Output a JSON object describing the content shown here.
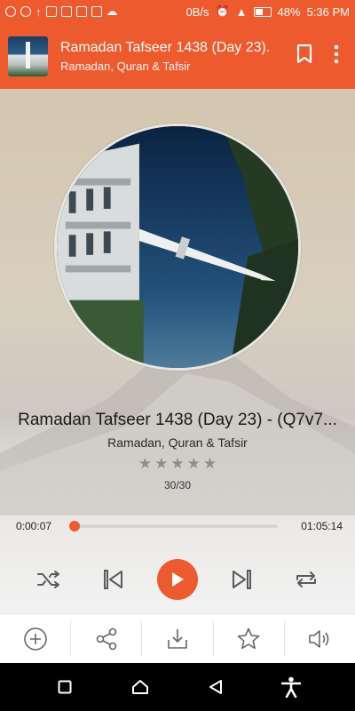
{
  "status_bar": {
    "speed": "0B/s",
    "battery": "48%",
    "time": "5:36 PM"
  },
  "app_bar": {
    "title": "Ramadan Tafseer 1438 (Day 23)..",
    "subtitle": "Ramadan, Quran & Tafsir",
    "icons": [
      "bookmark-icon",
      "more-vert-icon"
    ]
  },
  "player": {
    "track_title": "Ramadan Tafseer 1438 (Day 23) - (Q7v7...",
    "artist": "Ramadan, Quran & Tafsir",
    "rating": 0,
    "rating_max": 5,
    "track_position": "30/30",
    "time_elapsed": "0:00:07",
    "time_total": "01:05:14",
    "progress": 0.002,
    "controls": [
      "shuffle-icon",
      "previous-icon",
      "play-icon",
      "next-icon",
      "repeat-icon"
    ]
  },
  "action_bar": {
    "items": [
      "add-icon",
      "share-icon",
      "download-icon",
      "favorite-star-icon",
      "volume-icon"
    ]
  },
  "colors": {
    "accent": "#ec5a2e",
    "navbar": "#000000"
  }
}
